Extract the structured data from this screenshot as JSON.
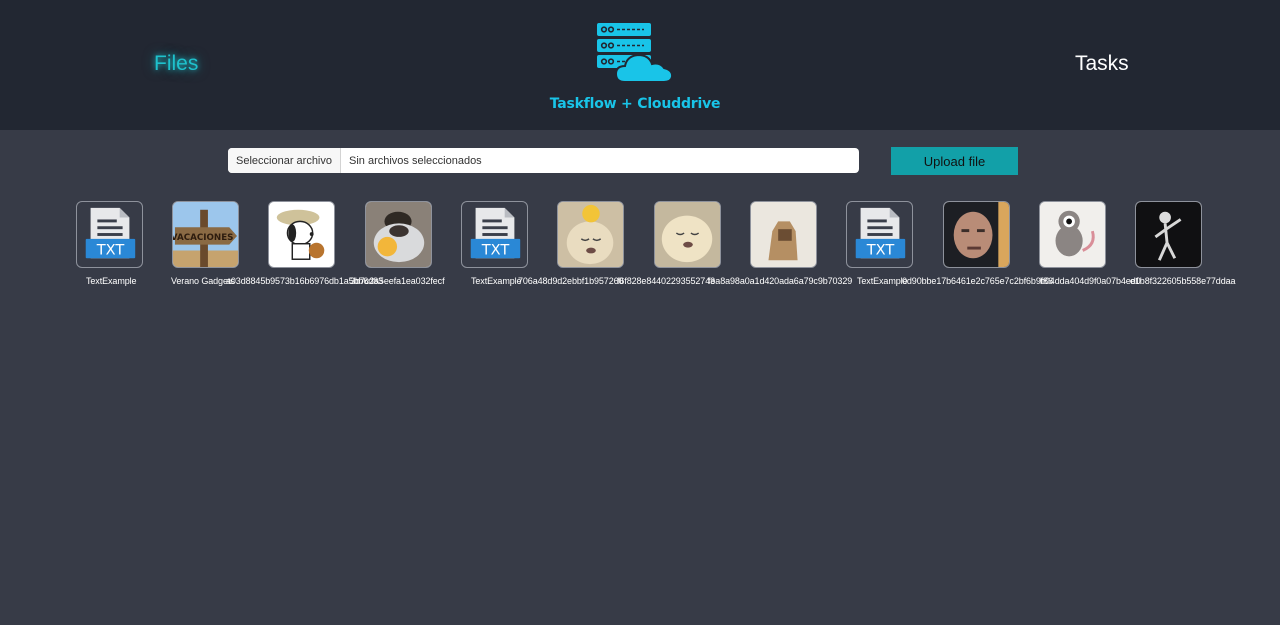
{
  "header": {
    "nav_files": "Files",
    "nav_tasks": "Tasks",
    "brand": "Taskflow + Clouddrive",
    "accent": "#1ec1cc",
    "logo_icon": "server-cloud-icon"
  },
  "upload": {
    "choose_label": "Seleccionar archivo",
    "status": "Sin archivos seleccionados",
    "button_label": "Upload file",
    "button_color": "#12a0a8"
  },
  "files": [
    {
      "name": "TextExample",
      "thumb": "txt-file-icon"
    },
    {
      "name": "Verano Gadgets",
      "thumb": "vacaciones-sign-image"
    },
    {
      "name": "a03d8845b9573b16b6976db1a5bb6d83",
      "thumb": "snoopy-image"
    },
    {
      "name": "3b7c2a5eefa1ea032fecf",
      "thumb": "puppy-bowl-image"
    },
    {
      "name": "TextExample",
      "thumb": "txt-file-icon"
    },
    {
      "name": "706a48d9d2ebbf1b957260",
      "thumb": "sad-puppy-image"
    },
    {
      "name": "f6f828e84402293552743",
      "thumb": "puppy-image"
    },
    {
      "name": "fea8a98a0a1d420ada6a79c9b70329",
      "thumb": "dog-image"
    },
    {
      "name": "TextExample",
      "thumb": "txt-file-icon"
    },
    {
      "name": "0d90bbe17b6461e2c765e7c2bf6b9f86",
      "thumb": "man-face-image"
    },
    {
      "name": "b04dda404d9f0a07b4ed0",
      "thumb": "cartoon-rat-image"
    },
    {
      "name": "e1b8f322605b558e77ddaa",
      "thumb": "dancing-figure-image"
    }
  ]
}
